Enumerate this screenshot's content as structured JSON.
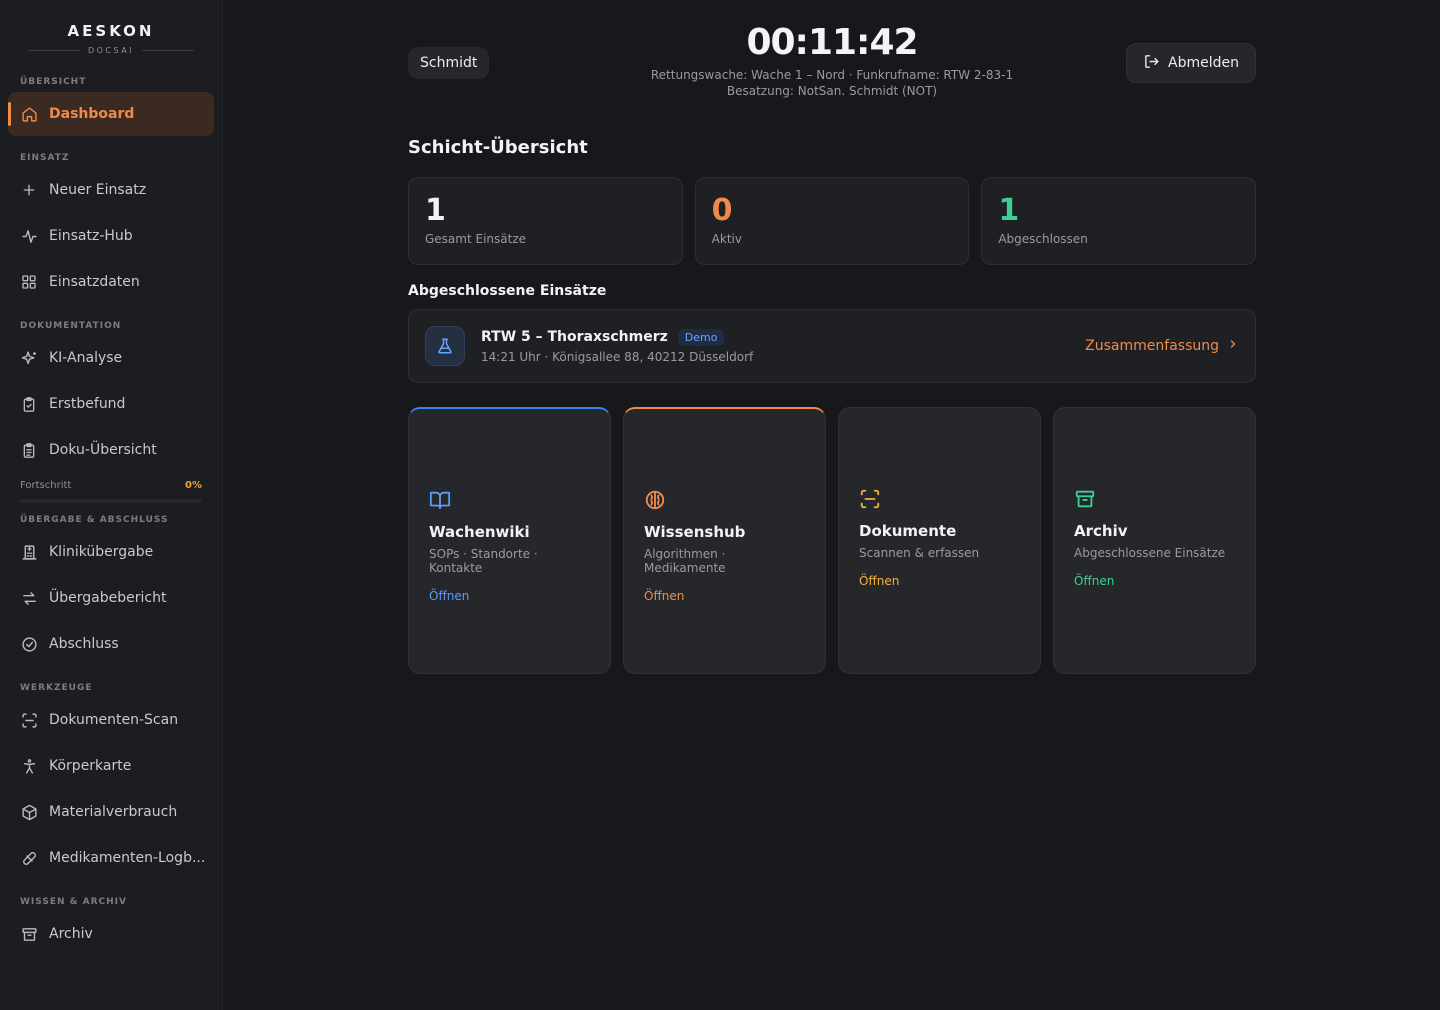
{
  "brand": {
    "title": "AESKON",
    "subtitle": "DOCSAI"
  },
  "sidebar": {
    "sections": [
      {
        "label": "ÜBERSICHT",
        "items": [
          {
            "label": "Dashboard",
            "icon": "home-icon",
            "active": true
          }
        ]
      },
      {
        "label": "EINSATZ",
        "items": [
          {
            "label": "Neuer Einsatz",
            "icon": "plus-icon"
          },
          {
            "label": "Einsatz-Hub",
            "icon": "activity-icon"
          },
          {
            "label": "Einsatzdaten",
            "icon": "grid-icon"
          }
        ]
      },
      {
        "label": "DOKUMENTATION",
        "items": [
          {
            "label": "KI-Analyse",
            "icon": "sparkles-icon"
          },
          {
            "label": "Erstbefund",
            "icon": "clipboard-check-icon"
          },
          {
            "label": "Doku-Übersicht",
            "icon": "clipboard-list-icon"
          }
        ]
      },
      {
        "label": "ÜBERGABE & ABSCHLUSS",
        "items": [
          {
            "label": "Klinikübergabe",
            "icon": "hospital-icon"
          },
          {
            "label": "Übergabebericht",
            "icon": "arrows-swap-icon"
          },
          {
            "label": "Abschluss",
            "icon": "check-circle-icon"
          }
        ]
      },
      {
        "label": "WERKZEUGE",
        "items": [
          {
            "label": "Dokumenten-Scan",
            "icon": "scan-icon"
          },
          {
            "label": "Körperkarte",
            "icon": "person-icon"
          },
          {
            "label": "Materialverbrauch",
            "icon": "package-icon"
          },
          {
            "label": "Medikamenten-Logb...",
            "icon": "pill-icon"
          }
        ]
      },
      {
        "label": "WISSEN & ARCHIV",
        "items": [
          {
            "label": "Archiv",
            "icon": "archive-icon"
          }
        ]
      }
    ],
    "progress": {
      "label": "Fortschritt",
      "value_text": "0%",
      "value": 0
    }
  },
  "header": {
    "user": "Schmidt",
    "clock": "00:11:42",
    "meta_line1": "Rettungswache: Wache 1 – Nord · Funkrufname: RTW 2-83-1",
    "meta_line2": "Besatzung: NotSan. Schmidt (NOT)",
    "logout_label": "Abmelden"
  },
  "overview": {
    "title": "Schicht-Übersicht",
    "stats": [
      {
        "value": "1",
        "label": "Gesamt Einsätze",
        "color": "#f3f3f5"
      },
      {
        "value": "0",
        "label": "Aktiv",
        "color": "#f08a4b"
      },
      {
        "value": "1",
        "label": "Abgeschlossen",
        "color": "#3ccf91"
      }
    ]
  },
  "completed": {
    "title": "Abgeschlossene Einsätze",
    "case": {
      "title": "RTW 5 – Thoraxschmerz",
      "badge": "Demo",
      "sub": "14:21 Uhr · Königsallee 88, 40212 Düsseldorf",
      "link": "Zusammenfassung"
    }
  },
  "tiles": [
    {
      "title": "Wachenwiki",
      "sub": "SOPs · Standorte · Kontakte",
      "link": "Öffnen",
      "color": "#5b9cf6",
      "icon": "book-icon"
    },
    {
      "title": "Wissenshub",
      "sub": "Algorithmen · Medikamente",
      "link": "Öffnen",
      "color": "#f08a4b",
      "icon": "brain-icon"
    },
    {
      "title": "Dokumente",
      "sub": "Scannen & erfassen",
      "link": "Öffnen",
      "color": "#f0b43c",
      "icon": "scan-icon"
    },
    {
      "title": "Archiv",
      "sub": "Abgeschlossene Einsätze",
      "link": "Öffnen",
      "color": "#3ccf91",
      "icon": "archive-icon"
    }
  ]
}
